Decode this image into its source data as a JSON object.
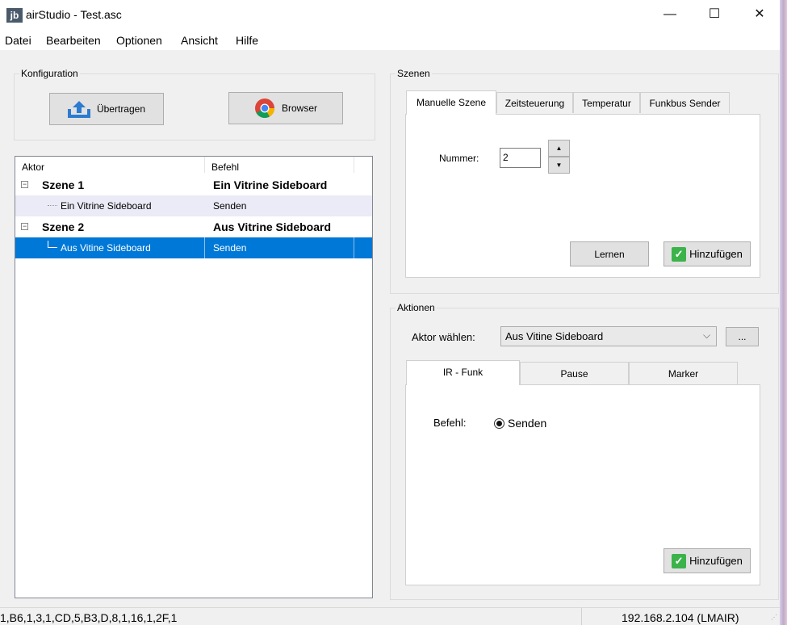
{
  "window": {
    "title": "airStudio - Test.asc",
    "icon_text": "jb",
    "minimize": "—",
    "maximize": "☐",
    "close": "✕"
  },
  "menu": [
    "Datei",
    "Bearbeiten",
    "Optionen",
    "Ansicht",
    "Hilfe"
  ],
  "konfiguration": {
    "legend": "Konfiguration",
    "upload_label": "Übertragen",
    "browser_label": "Browser"
  },
  "tree": {
    "columns": [
      "Aktor",
      "Befehl"
    ],
    "rows": [
      {
        "aktor": "Szene 1",
        "befehl": "Ein Vitrine Sideboard",
        "expander": "⊟"
      },
      {
        "aktor": "Ein Vitrine Sideboard",
        "befehl": "Senden"
      },
      {
        "aktor": "Szene 2",
        "befehl": "Aus Vitrine Sideboard",
        "expander": "⊟"
      },
      {
        "aktor": "Aus Vitine Sideboard",
        "befehl": "Senden"
      }
    ]
  },
  "szenen": {
    "legend": "Szenen",
    "tabs": [
      "Manuelle Szene",
      "Zeitsteuerung",
      "Temperatur",
      "Funkbus Sender"
    ],
    "nummer_label": "Nummer:",
    "nummer_value": "2",
    "lernen_label": "Lernen",
    "hinzufuegen_label": "Hinzufügen"
  },
  "aktionen": {
    "legend": "Aktionen",
    "aktor_label": "Aktor wählen:",
    "aktor_value": "Aus Vitine Sideboard",
    "more_label": "...",
    "tabs": [
      "IR - Funk",
      "Pause",
      "Marker"
    ],
    "befehl_label": "Befehl:",
    "befehl_option": "Senden",
    "hinzufuegen_label": "Hinzufügen"
  },
  "status": {
    "left": "1,B6,1,3,1,CD,5,B3,D,8,1,16,1,2F,1",
    "right": "192.168.2.104 (LMAIR)"
  },
  "colors": {
    "selection": "#0078d7",
    "alt_row": "#ebebf7",
    "check": "#3bb34a"
  }
}
